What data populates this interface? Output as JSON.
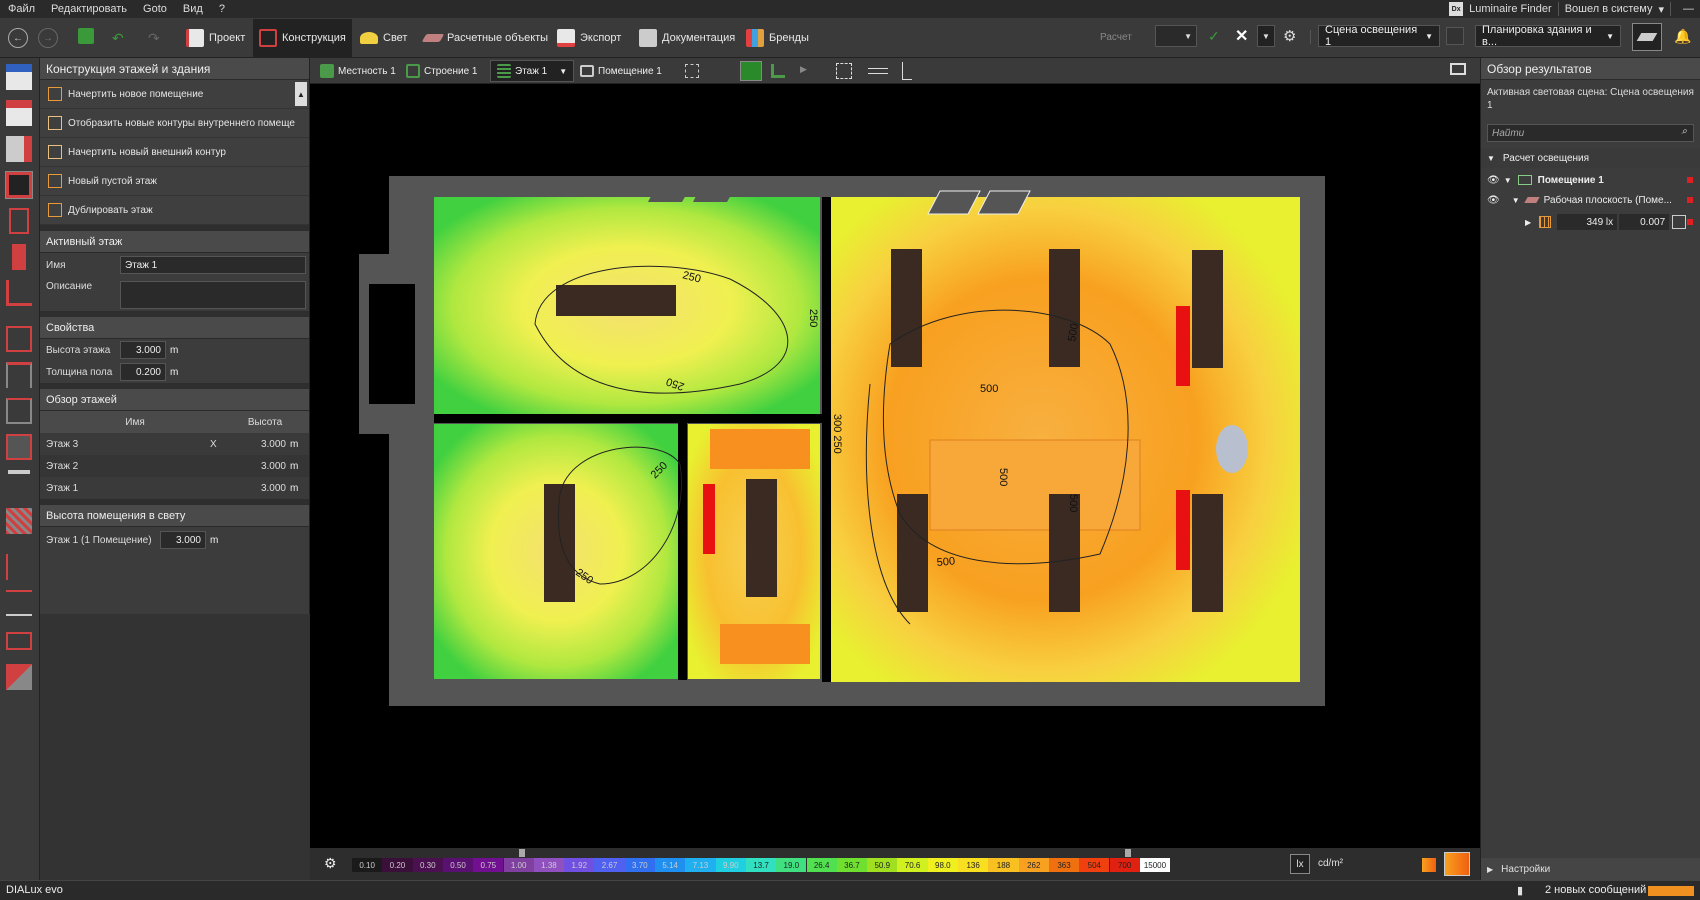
{
  "menu": {
    "items": [
      "Файл",
      "Редактировать",
      "Goto",
      "Вид",
      "?"
    ],
    "luminaire_finder": "Luminaire Finder",
    "logo_text": "Dx",
    "login": "Вошел в систему"
  },
  "toolbar": {
    "tabs": [
      {
        "label": "Проект",
        "color": "#e8e8e8"
      },
      {
        "label": "Конструкция",
        "color": "#d04040"
      },
      {
        "label": "Свет",
        "color": "#f0d040"
      },
      {
        "label": "Расчетные объекты",
        "color": "#c08080"
      },
      {
        "label": "Экспорт",
        "color": "#e04040"
      },
      {
        "label": "Документация",
        "color": "#cccccc"
      },
      {
        "label": "Бренды",
        "color": "#e0a040"
      }
    ],
    "calc_label": "Расчет",
    "scene_select": "Сцена освещения 1",
    "plan_select": "Планировка здания и в..."
  },
  "left_panel": {
    "title": "Конструкция этажей и здания",
    "commands": [
      "Начертить новое помещение",
      "Отобразить новые контуры внутреннего помеще",
      "Начертить новый внешний контур",
      "Новый пустой этаж",
      "Дублировать этаж"
    ],
    "active_floor": {
      "header": "Активный этаж",
      "name_label": "Имя",
      "name_value": "Этаж 1",
      "desc_label": "Описание"
    },
    "properties": {
      "header": "Свойства",
      "height_label": "Высота этажа",
      "height_value": "3.000",
      "floor_label": "Толщина пола",
      "floor_value": "0.200",
      "unit": "m"
    },
    "floors": {
      "header": "Обзор этажей",
      "col_name": "Имя",
      "col_height": "Высота",
      "rows": [
        {
          "name": "Этаж 3",
          "x": "X",
          "height": "3.000"
        },
        {
          "name": "Этаж 2",
          "x": "",
          "height": "3.000"
        },
        {
          "name": "Этаж 1",
          "x": "",
          "height": "3.000"
        }
      ],
      "unit": "m"
    },
    "room_height": {
      "header": "Высота помещения в свету",
      "label": "Этаж 1 (1 Помещение)",
      "value": "3.000",
      "unit": "m"
    }
  },
  "view_tabs": {
    "items": [
      "Местность 1",
      "Строение 1",
      "Этаж 1",
      "Помещение 1"
    ]
  },
  "contours": [
    "250",
    "250",
    "250",
    "250",
    "250",
    "500",
    "500",
    "500",
    "500",
    "500",
    "300 250"
  ],
  "scale": {
    "values": [
      "0.10",
      "0.20",
      "0.30",
      "0.50",
      "0.75",
      "1.00",
      "1.38",
      "1.92",
      "2.67",
      "3.70",
      "5.14",
      "7.13",
      "9.90",
      "13.7",
      "19.0",
      "26.4",
      "36.7",
      "50.9",
      "70.6",
      "98.0",
      "136",
      "188",
      "262",
      "363",
      "504",
      "700",
      "15000"
    ],
    "colors": [
      "#1a1a1a",
      "#3a0f3a",
      "#4a1050",
      "#5a1070",
      "#701090",
      "#8040a0",
      "#9050c0",
      "#7050e0",
      "#5060f0",
      "#3070f0",
      "#2090f0",
      "#20b0f0",
      "#20d0e0",
      "#30e0c0",
      "#40e080",
      "#50e050",
      "#70e030",
      "#a0e020",
      "#d0f020",
      "#f0f020",
      "#f8e020",
      "#f8c020",
      "#f8a020",
      "#f07010",
      "#f04010",
      "#e02010",
      "#ffffff"
    ],
    "unit1": "lx",
    "unit2": "cd/m²"
  },
  "right_panel": {
    "title": "Обзор результатов",
    "active_scene": "Активная световая сцена: Сцена освещения 1",
    "search_placeholder": "Найти",
    "calc_header": "Расчет освещения",
    "room": "Помещение 1",
    "workplane": "Рабочая плоскость (Поме...",
    "lux": "349 lx",
    "ratio": "0.007",
    "settings": "Настройки"
  },
  "status": {
    "logo": "DIALux evo",
    "messages": "2 новых сообщений"
  }
}
